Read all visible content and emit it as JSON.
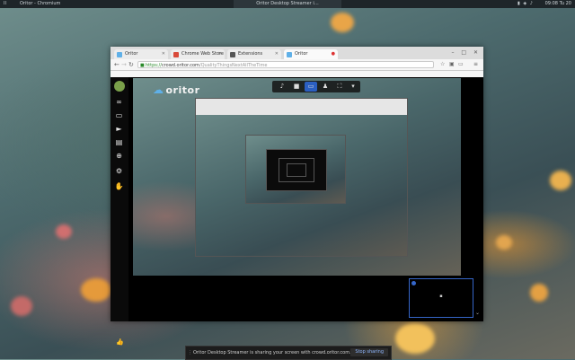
{
  "topbar": {
    "workspace": "II",
    "app_title": "Oritor - Chromium",
    "center_title": "Oritor Desktop Streamer i…",
    "clock": "09:08 Tu 20"
  },
  "browser": {
    "tabs": [
      {
        "label": "Oritor",
        "color": "#5fb0e8"
      },
      {
        "label": "Chrome Web Store",
        "color": "#d94a3a"
      },
      {
        "label": "Extensions",
        "color": "#555555"
      },
      {
        "label": "Oritor",
        "color": "#5fb0e8"
      }
    ],
    "url_host": "crowd.oritor.com",
    "url_path": "/QualityThingsNextAllTheTime",
    "url_scheme": "https://",
    "bookmarks": [
      "",
      ""
    ]
  },
  "app": {
    "logo_text": "oritor",
    "bottom_preview_label": "▪",
    "toolbar": {
      "mic_icon": "microphone-icon",
      "camera_icon": "camera-icon",
      "screen_icon": "screen-share-icon",
      "people_icon": "people-icon",
      "fullscreen_icon": "fullscreen-icon",
      "chevron_icon": "chevron-down-icon"
    }
  },
  "share_notice": {
    "text": "Oritor Desktop Streamer is sharing your screen with crowd.oritor.com.",
    "stop_label": "Stop sharing"
  },
  "colors": {
    "accent": "#2b5fc2",
    "logo_cloud": "#5fb0e8"
  }
}
